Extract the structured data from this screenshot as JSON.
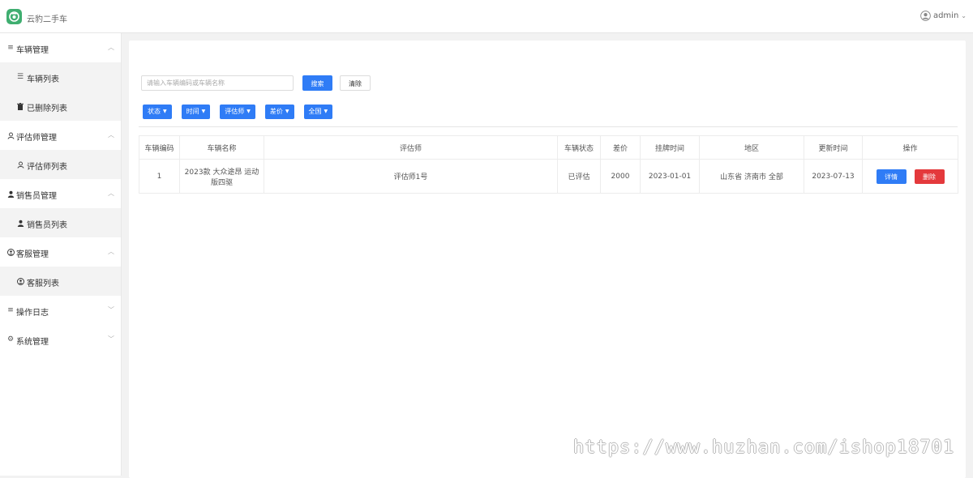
{
  "header": {
    "app_title": "云豹二手车",
    "user_name": "admin"
  },
  "sidebar": {
    "groups": [
      {
        "label": "车辆管理",
        "expanded": true,
        "icon": "menu-icon",
        "items": [
          {
            "label": "车辆列表",
            "icon": "list-icon"
          },
          {
            "label": "已删除列表",
            "icon": "trash-icon"
          }
        ]
      },
      {
        "label": "评估师管理",
        "expanded": true,
        "icon": "user-outline-icon",
        "items": [
          {
            "label": "评估师列表",
            "icon": "user-outline-icon"
          }
        ]
      },
      {
        "label": "销售员管理",
        "expanded": true,
        "icon": "user-icon",
        "items": [
          {
            "label": "销售员列表",
            "icon": "user-icon"
          }
        ]
      },
      {
        "label": "客服管理",
        "expanded": true,
        "icon": "headset-icon",
        "items": [
          {
            "label": "客服列表",
            "icon": "headset-icon"
          }
        ]
      },
      {
        "label": "操作日志",
        "expanded": false,
        "icon": "menu-icon",
        "items": []
      },
      {
        "label": "系统管理",
        "expanded": false,
        "icon": "gear-icon",
        "items": []
      }
    ]
  },
  "search": {
    "placeholder": "请输入车辆编码或车辆名称",
    "search_label": "搜索",
    "clear_label": "清除"
  },
  "filters": [
    "状态",
    "时间",
    "评估师",
    "差价",
    "全国"
  ],
  "table": {
    "columns": [
      "车辆编码",
      "车辆名称",
      "评估师",
      "车辆状态",
      "差价",
      "挂牌时间",
      "地区",
      "更新时间",
      "操作"
    ],
    "rows": [
      {
        "id": "1",
        "name": "2023款 大众途昂 运动版四驱",
        "appraiser": "评估师1号",
        "status": "已评估",
        "price_diff": "2000",
        "listing_date": "2023-01-01",
        "region": "山东省 济南市 全部",
        "updated": "2023-07-13",
        "detail_label": "详情",
        "delete_label": "删除"
      }
    ]
  },
  "colors": {
    "primary": "#2f7cf6",
    "danger": "#e4393c",
    "logo": "#3fae70"
  },
  "watermark": "https://www.huzhan.com/ishop18701"
}
